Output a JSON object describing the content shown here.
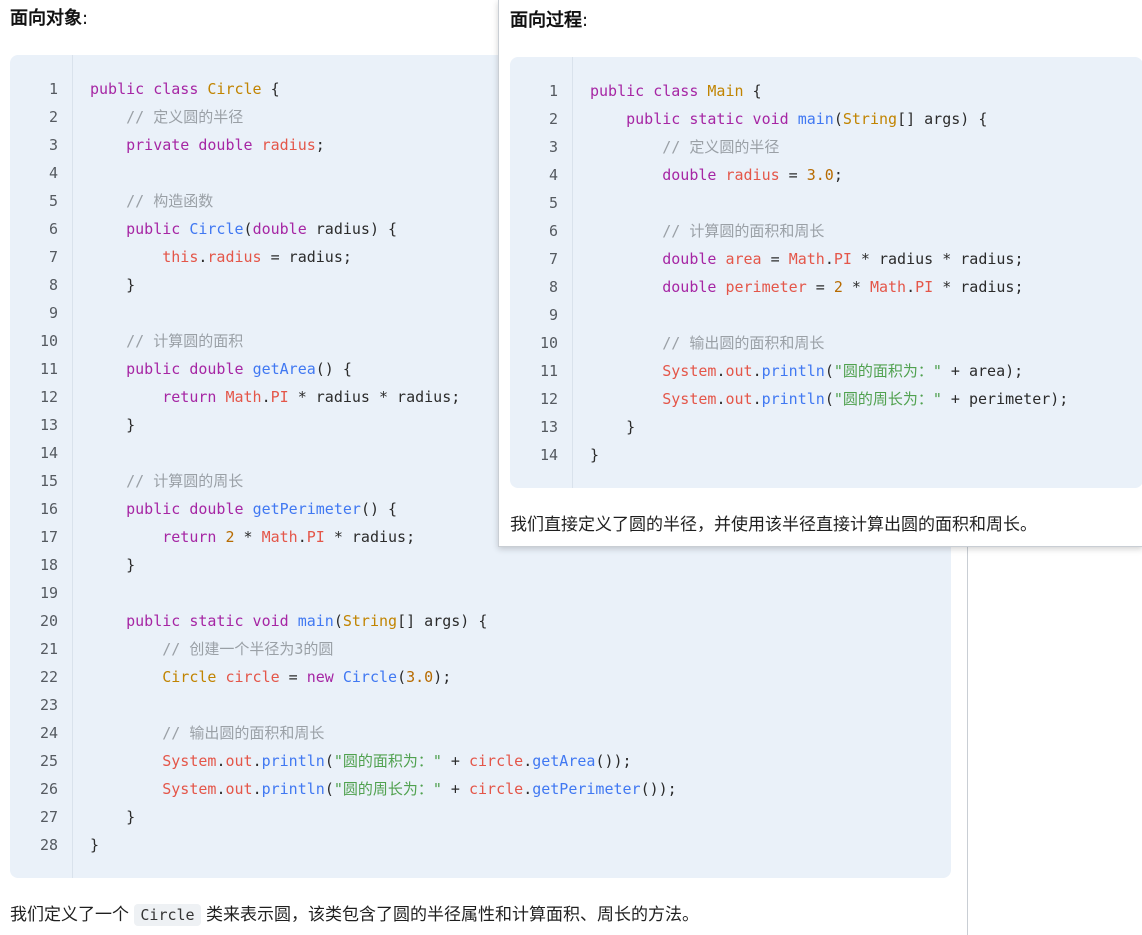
{
  "left": {
    "heading": "面向对象",
    "colon": ":",
    "code_lines": [
      {
        "n": "1",
        "t": [
          [
            "k",
            "public class "
          ],
          [
            "t",
            "Circle"
          ],
          [
            "p",
            " {"
          ]
        ]
      },
      {
        "n": "2",
        "t": [
          [
            "p",
            "    "
          ],
          [
            "c",
            "// 定义圆的半径"
          ]
        ]
      },
      {
        "n": "3",
        "t": [
          [
            "p",
            "    "
          ],
          [
            "k",
            "private double "
          ],
          [
            "v",
            "radius"
          ],
          [
            "p",
            ";"
          ]
        ]
      },
      {
        "n": "4",
        "t": []
      },
      {
        "n": "5",
        "t": [
          [
            "p",
            "    "
          ],
          [
            "c",
            "// 构造函数"
          ]
        ]
      },
      {
        "n": "6",
        "t": [
          [
            "p",
            "    "
          ],
          [
            "k",
            "public "
          ],
          [
            "f",
            "Circle"
          ],
          [
            "p",
            "("
          ],
          [
            "k",
            "double"
          ],
          [
            "p",
            " radius) {"
          ]
        ]
      },
      {
        "n": "7",
        "t": [
          [
            "p",
            "        "
          ],
          [
            "v",
            "this"
          ],
          [
            "p",
            "."
          ],
          [
            "v",
            "radius"
          ],
          [
            "p",
            " = radius;"
          ]
        ]
      },
      {
        "n": "8",
        "t": [
          [
            "p",
            "    }"
          ]
        ]
      },
      {
        "n": "9",
        "t": []
      },
      {
        "n": "10",
        "t": [
          [
            "p",
            "    "
          ],
          [
            "c",
            "// 计算圆的面积"
          ]
        ]
      },
      {
        "n": "11",
        "t": [
          [
            "p",
            "    "
          ],
          [
            "k",
            "public double "
          ],
          [
            "f",
            "getArea"
          ],
          [
            "p",
            "() {"
          ]
        ]
      },
      {
        "n": "12",
        "t": [
          [
            "p",
            "        "
          ],
          [
            "k",
            "return "
          ],
          [
            "v",
            "Math"
          ],
          [
            "p",
            "."
          ],
          [
            "v",
            "PI"
          ],
          [
            "p",
            " * radius * radius;"
          ]
        ]
      },
      {
        "n": "13",
        "t": [
          [
            "p",
            "    }"
          ]
        ]
      },
      {
        "n": "14",
        "t": []
      },
      {
        "n": "15",
        "t": [
          [
            "p",
            "    "
          ],
          [
            "c",
            "// 计算圆的周长"
          ]
        ]
      },
      {
        "n": "16",
        "t": [
          [
            "p",
            "    "
          ],
          [
            "k",
            "public double "
          ],
          [
            "f",
            "getPerimeter"
          ],
          [
            "p",
            "() {"
          ]
        ]
      },
      {
        "n": "17",
        "t": [
          [
            "p",
            "        "
          ],
          [
            "k",
            "return "
          ],
          [
            "n",
            "2"
          ],
          [
            "p",
            " * "
          ],
          [
            "v",
            "Math"
          ],
          [
            "p",
            "."
          ],
          [
            "v",
            "PI"
          ],
          [
            "p",
            " * radius;"
          ]
        ]
      },
      {
        "n": "18",
        "t": [
          [
            "p",
            "    }"
          ]
        ]
      },
      {
        "n": "19",
        "t": []
      },
      {
        "n": "20",
        "t": [
          [
            "p",
            "    "
          ],
          [
            "k",
            "public static void "
          ],
          [
            "f",
            "main"
          ],
          [
            "p",
            "("
          ],
          [
            "t",
            "String"
          ],
          [
            "p",
            "[] args) {"
          ]
        ]
      },
      {
        "n": "21",
        "t": [
          [
            "p",
            "        "
          ],
          [
            "c",
            "// 创建一个半径为3的圆"
          ]
        ]
      },
      {
        "n": "22",
        "t": [
          [
            "p",
            "        "
          ],
          [
            "t",
            "Circle"
          ],
          [
            "p",
            " "
          ],
          [
            "v",
            "circle"
          ],
          [
            "p",
            " = "
          ],
          [
            "k",
            "new "
          ],
          [
            "f",
            "Circle"
          ],
          [
            "p",
            "("
          ],
          [
            "n",
            "3.0"
          ],
          [
            "p",
            ");"
          ]
        ]
      },
      {
        "n": "23",
        "t": []
      },
      {
        "n": "24",
        "t": [
          [
            "p",
            "        "
          ],
          [
            "c",
            "// 输出圆的面积和周长"
          ]
        ]
      },
      {
        "n": "25",
        "t": [
          [
            "p",
            "        "
          ],
          [
            "v",
            "System"
          ],
          [
            "p",
            "."
          ],
          [
            "v",
            "out"
          ],
          [
            "p",
            "."
          ],
          [
            "f",
            "println"
          ],
          [
            "p",
            "("
          ],
          [
            "s",
            "\"圆的面积为：\""
          ],
          [
            "p",
            " + "
          ],
          [
            "v",
            "circle"
          ],
          [
            "p",
            "."
          ],
          [
            "f",
            "getArea"
          ],
          [
            "p",
            "());"
          ]
        ]
      },
      {
        "n": "26",
        "t": [
          [
            "p",
            "        "
          ],
          [
            "v",
            "System"
          ],
          [
            "p",
            "."
          ],
          [
            "v",
            "out"
          ],
          [
            "p",
            "."
          ],
          [
            "f",
            "println"
          ],
          [
            "p",
            "("
          ],
          [
            "s",
            "\"圆的周长为：\""
          ],
          [
            "p",
            " + "
          ],
          [
            "v",
            "circle"
          ],
          [
            "p",
            "."
          ],
          [
            "f",
            "getPerimeter"
          ],
          [
            "p",
            "());"
          ]
        ]
      },
      {
        "n": "27",
        "t": [
          [
            "p",
            "    }"
          ]
        ]
      },
      {
        "n": "28",
        "t": [
          [
            "p",
            "}"
          ]
        ]
      }
    ],
    "desc_before": "我们定义了一个",
    "desc_code": "Circle",
    "desc_after": "类来表示圆，该类包含了圆的半径属性和计算面积、周长的方法。"
  },
  "right": {
    "heading": "面向过程",
    "colon": ":",
    "code_lines": [
      {
        "n": "1",
        "t": [
          [
            "k",
            "public class "
          ],
          [
            "t",
            "Main"
          ],
          [
            "p",
            " {"
          ]
        ]
      },
      {
        "n": "2",
        "t": [
          [
            "p",
            "    "
          ],
          [
            "k",
            "public static void "
          ],
          [
            "f",
            "main"
          ],
          [
            "p",
            "("
          ],
          [
            "t",
            "String"
          ],
          [
            "p",
            "[] args) {"
          ]
        ]
      },
      {
        "n": "3",
        "t": [
          [
            "p",
            "        "
          ],
          [
            "c",
            "// 定义圆的半径"
          ]
        ]
      },
      {
        "n": "4",
        "t": [
          [
            "p",
            "        "
          ],
          [
            "k",
            "double "
          ],
          [
            "v",
            "radius"
          ],
          [
            "p",
            " = "
          ],
          [
            "n",
            "3.0"
          ],
          [
            "p",
            ";"
          ]
        ]
      },
      {
        "n": "5",
        "t": []
      },
      {
        "n": "6",
        "t": [
          [
            "p",
            "        "
          ],
          [
            "c",
            "// 计算圆的面积和周长"
          ]
        ]
      },
      {
        "n": "7",
        "t": [
          [
            "p",
            "        "
          ],
          [
            "k",
            "double "
          ],
          [
            "v",
            "area"
          ],
          [
            "p",
            " = "
          ],
          [
            "v",
            "Math"
          ],
          [
            "p",
            "."
          ],
          [
            "v",
            "PI"
          ],
          [
            "p",
            " * radius * radius;"
          ]
        ]
      },
      {
        "n": "8",
        "t": [
          [
            "p",
            "        "
          ],
          [
            "k",
            "double "
          ],
          [
            "v",
            "perimeter"
          ],
          [
            "p",
            " = "
          ],
          [
            "n",
            "2"
          ],
          [
            "p",
            " * "
          ],
          [
            "v",
            "Math"
          ],
          [
            "p",
            "."
          ],
          [
            "v",
            "PI"
          ],
          [
            "p",
            " * radius;"
          ]
        ]
      },
      {
        "n": "9",
        "t": []
      },
      {
        "n": "10",
        "t": [
          [
            "p",
            "        "
          ],
          [
            "c",
            "// 输出圆的面积和周长"
          ]
        ]
      },
      {
        "n": "11",
        "t": [
          [
            "p",
            "        "
          ],
          [
            "v",
            "System"
          ],
          [
            "p",
            "."
          ],
          [
            "v",
            "out"
          ],
          [
            "p",
            "."
          ],
          [
            "f",
            "println"
          ],
          [
            "p",
            "("
          ],
          [
            "s",
            "\"圆的面积为：\""
          ],
          [
            "p",
            " + area);"
          ]
        ]
      },
      {
        "n": "12",
        "t": [
          [
            "p",
            "        "
          ],
          [
            "v",
            "System"
          ],
          [
            "p",
            "."
          ],
          [
            "v",
            "out"
          ],
          [
            "p",
            "."
          ],
          [
            "f",
            "println"
          ],
          [
            "p",
            "("
          ],
          [
            "s",
            "\"圆的周长为：\""
          ],
          [
            "p",
            " + perimeter);"
          ]
        ]
      },
      {
        "n": "13",
        "t": [
          [
            "p",
            "    }"
          ]
        ]
      },
      {
        "n": "14",
        "t": [
          [
            "p",
            "}"
          ]
        ]
      }
    ],
    "desc": "我们直接定义了圆的半径，并使用该半径直接计算出圆的面积和周长。"
  },
  "colors": {
    "code_bg": "#eaf1f9",
    "keyword": "#a626a4",
    "type": "#c18401",
    "function": "#4078f2",
    "variable": "#e45649",
    "number": "#b76b01",
    "string": "#50a14f",
    "comment": "#9aa0a6"
  }
}
